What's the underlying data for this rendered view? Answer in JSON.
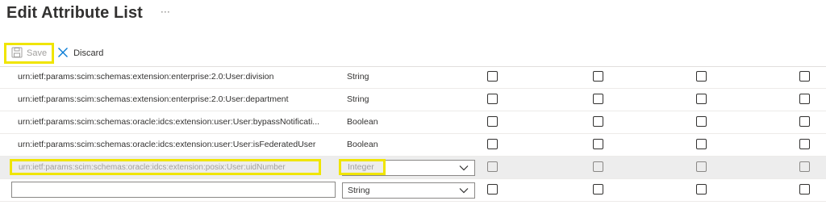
{
  "header": {
    "title": "Edit Attribute List",
    "more_label": "···"
  },
  "toolbar": {
    "save_label": "Save",
    "discard_label": "Discard"
  },
  "rows": [
    {
      "name": "urn:ietf:params:scim:schemas:extension:enterprise:2.0:User:division",
      "type": "String"
    },
    {
      "name": "urn:ietf:params:scim:schemas:extension:enterprise:2.0:User:department",
      "type": "String"
    },
    {
      "name": "urn:ietf:params:scim:schemas:oracle:idcs:extension:user:User:bypassNotificati...",
      "type": "Boolean"
    },
    {
      "name": "urn:ietf:params:scim:schemas:oracle:idcs:extension:user:User:isFederatedUser",
      "type": "Boolean"
    }
  ],
  "disabled_row": {
    "name": "urn:ietf:params:scim:schemas:oracle:idcs:extension:posix:User:uidNumber",
    "type": "Integer"
  },
  "new_row": {
    "name": "",
    "type": "String"
  },
  "colors": {
    "highlight": "#f0e500",
    "disabled_bg": "#ededed",
    "accent": "#0078d4"
  }
}
